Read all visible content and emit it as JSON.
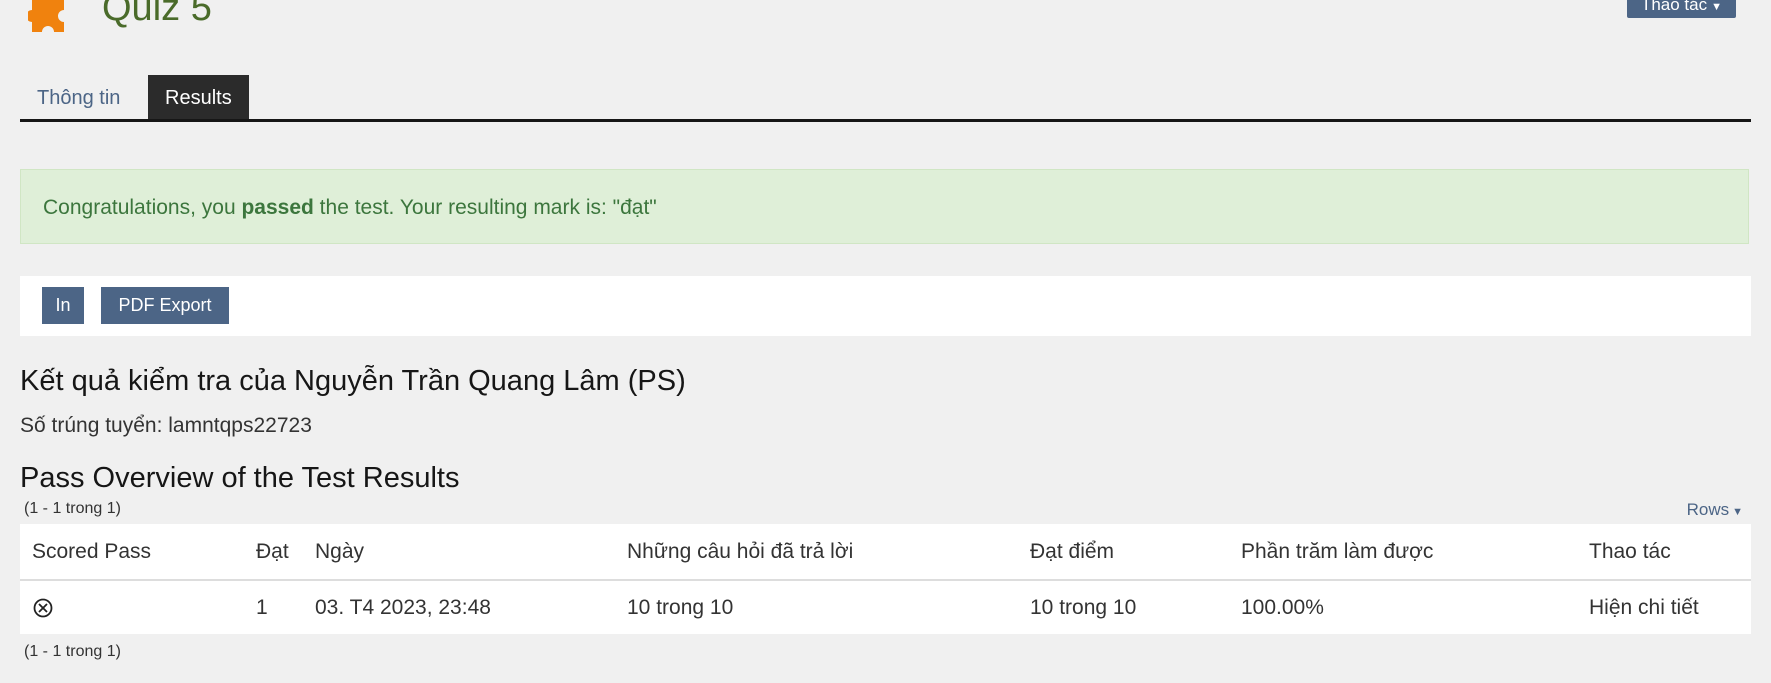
{
  "header": {
    "title": "Quiz 5",
    "actions_label": "Thao tác",
    "accent_color": "#4a6b2a",
    "icon": "puzzle-icon"
  },
  "tabs": [
    {
      "label": "Thông tin",
      "active": false
    },
    {
      "label": "Results",
      "active": true
    }
  ],
  "alert": {
    "prefix": "Congratulations, you ",
    "emphasis": "passed",
    "suffix": " the test. Your resulting mark is: \"đạt\"",
    "color": "#3c763d"
  },
  "toolbar": {
    "print_label": "In",
    "pdf_label": "PDF Export"
  },
  "result": {
    "title": "Kết quả kiểm tra của Nguyễn Trần Quang Lâm (PS)",
    "registration": "Số trúng tuyển: lamntqps22723"
  },
  "overview": {
    "title": "Pass Overview of the Test Results",
    "range_top": "(1 - 1 trong 1)",
    "range_bottom": "(1 - 1 trong 1)",
    "rows_label": "Rows"
  },
  "table": {
    "headers": [
      "Scored Pass",
      "Đạt",
      "Ngày",
      "Những câu hỏi đã trả lời",
      "Đạt điểm",
      "Phần trăm làm được",
      "Thao tác"
    ],
    "rows": [
      {
        "scored_pass_icon": "circle-x-icon",
        "pass": "1",
        "date": "03. T4 2023, 23:48",
        "answered": "10 trong 10",
        "points": "10 trong 10",
        "percent": "100.00%",
        "action": "Hiện chi tiết"
      }
    ]
  }
}
